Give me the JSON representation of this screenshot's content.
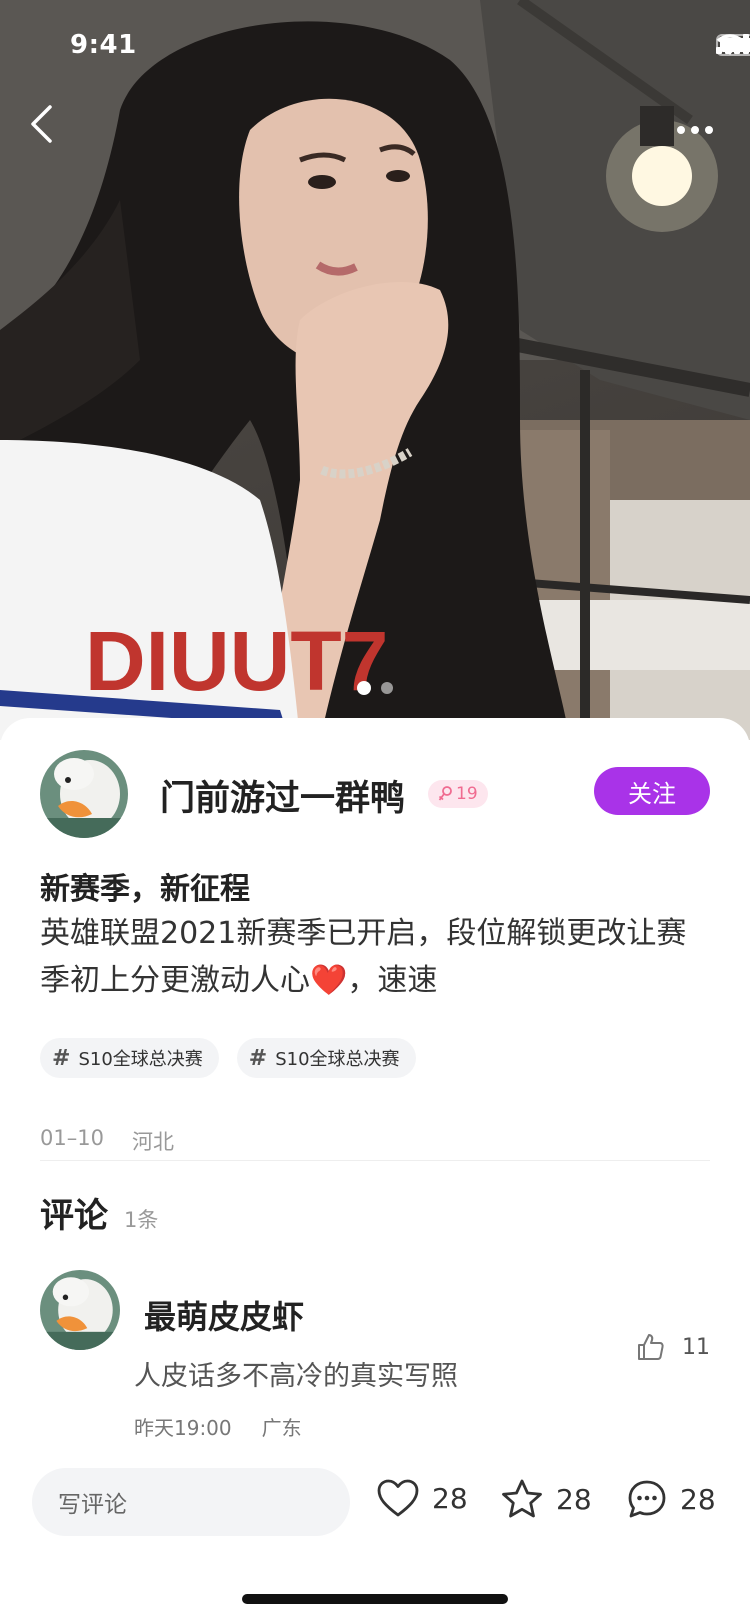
{
  "status_bar": {
    "time": "9:41"
  },
  "hero": {
    "background_colors": [
      "#5e5a55",
      "#3a3633"
    ],
    "carousel": {
      "total": 2,
      "active_index": 0
    }
  },
  "author": {
    "name": "门前游过一群鸭",
    "level": "19",
    "level_icon": "gender-female-icon",
    "follow_label": "关注",
    "follow_color": "#a933e8"
  },
  "post": {
    "title": "新赛季，新征程",
    "body": "英雄联盟2021新赛季已开启，段位解锁更改让赛季初上分更激动人心❤️，速速",
    "tags": [
      {
        "hash": "#",
        "label": "S10全球总决赛"
      },
      {
        "hash": "#",
        "label": "S10全球总决赛"
      }
    ],
    "date": "01–10",
    "location": "河北"
  },
  "comments_section": {
    "title": "评论",
    "count": "1条",
    "items": [
      {
        "name": "最萌皮皮虾",
        "text": "人皮话多不高冷的真实写照",
        "time": "昨天19:00",
        "location": "广东",
        "likes": "11"
      }
    ]
  },
  "action_bar": {
    "input_placeholder": "写评论",
    "likes": "28",
    "favorites": "28",
    "comments": "28"
  }
}
